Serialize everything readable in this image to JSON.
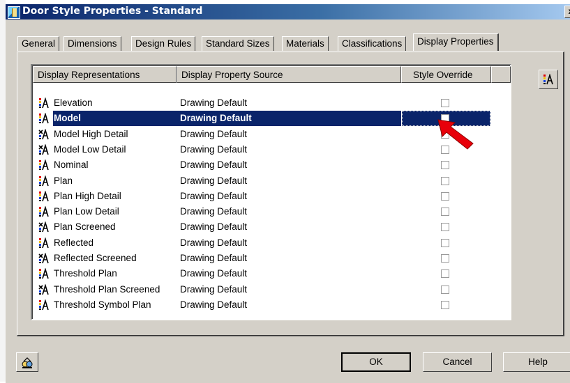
{
  "window": {
    "title": "Door Style Properties - Standard",
    "close_label": "x"
  },
  "tabs": [
    {
      "label": "General",
      "active": false
    },
    {
      "label": "Dimensions",
      "active": false
    },
    {
      "label": "Design Rules",
      "active": false
    },
    {
      "label": "Standard Sizes",
      "active": false
    },
    {
      "label": "Materials",
      "active": false
    },
    {
      "label": "Classifications",
      "active": false
    },
    {
      "label": "Display Properties",
      "active": true
    }
  ],
  "list": {
    "columns": [
      "Display Representations",
      "Display Property Source",
      "Style Override"
    ],
    "rows": [
      {
        "name": "Elevation",
        "source": "Drawing Default",
        "override": false,
        "icon": "display-rep-icon",
        "selected": false
      },
      {
        "name": "Model",
        "source": "Drawing Default",
        "override": false,
        "icon": "display-rep-icon",
        "selected": true
      },
      {
        "name": "Model High Detail",
        "source": "Drawing Default",
        "override": false,
        "icon": "display-rep-alt-icon",
        "selected": false
      },
      {
        "name": "Model Low Detail",
        "source": "Drawing Default",
        "override": false,
        "icon": "display-rep-alt-icon",
        "selected": false
      },
      {
        "name": "Nominal",
        "source": "Drawing Default",
        "override": false,
        "icon": "display-rep-icon",
        "selected": false
      },
      {
        "name": "Plan",
        "source": "Drawing Default",
        "override": false,
        "icon": "display-rep-icon",
        "selected": false
      },
      {
        "name": "Plan High Detail",
        "source": "Drawing Default",
        "override": false,
        "icon": "display-rep-icon",
        "selected": false
      },
      {
        "name": "Plan Low Detail",
        "source": "Drawing Default",
        "override": false,
        "icon": "display-rep-icon",
        "selected": false
      },
      {
        "name": "Plan Screened",
        "source": "Drawing Default",
        "override": false,
        "icon": "display-rep-alt-icon",
        "selected": false
      },
      {
        "name": "Reflected",
        "source": "Drawing Default",
        "override": false,
        "icon": "display-rep-icon",
        "selected": false
      },
      {
        "name": "Reflected Screened",
        "source": "Drawing Default",
        "override": false,
        "icon": "display-rep-alt-icon",
        "selected": false
      },
      {
        "name": "Threshold Plan",
        "source": "Drawing Default",
        "override": false,
        "icon": "display-rep-icon",
        "selected": false
      },
      {
        "name": "Threshold Plan Screened",
        "source": "Drawing Default",
        "override": false,
        "icon": "display-rep-alt-icon",
        "selected": false
      },
      {
        "name": "Threshold Symbol Plan",
        "source": "Drawing Default",
        "override": false,
        "icon": "display-rep-icon",
        "selected": false
      }
    ]
  },
  "side_button": {
    "icon": "display-rep-icon"
  },
  "buttons": {
    "ok": "OK",
    "cancel": "Cancel",
    "help": "Help",
    "left_icon": "style-manager-icon"
  },
  "colors": {
    "selection": "#0a246a",
    "title_gradient_start": "#0a246a",
    "title_gradient_end": "#a6caf0",
    "dialog_face": "#d4d0c8",
    "pointer_arrow": "#e8000a"
  }
}
